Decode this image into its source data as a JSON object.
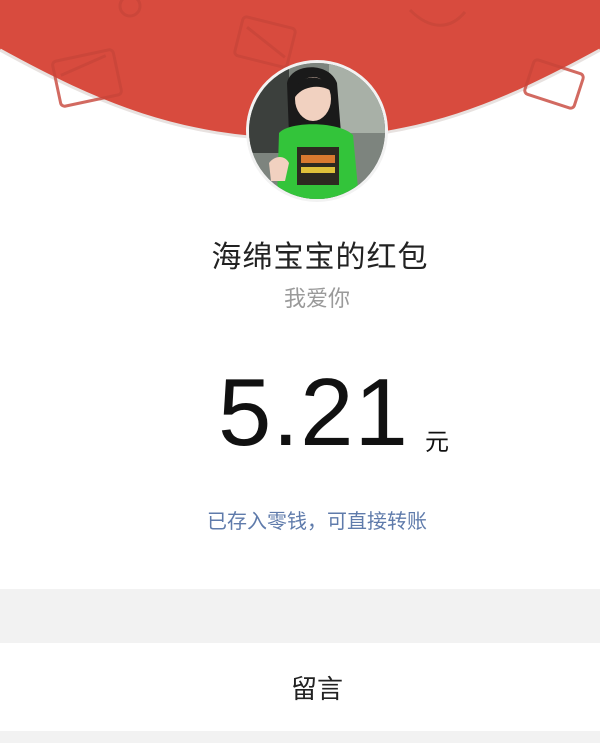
{
  "header": {
    "accent_color": "#d84b3e",
    "avatar": "avatar-photo"
  },
  "envelope": {
    "sender_title": "海绵宝宝的红包",
    "greeting": "我爱你",
    "amount": "5.21",
    "unit": "元",
    "wallet_link": "已存入零钱，可直接转账"
  },
  "message": {
    "label": "留言"
  }
}
